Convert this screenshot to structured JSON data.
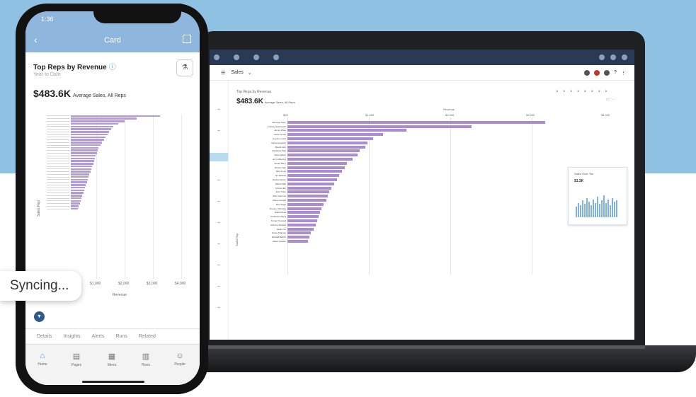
{
  "phone": {
    "status_time": "1:36",
    "nav_title": "Card",
    "card_title": "Top Reps by Revenue",
    "card_subtitle": "Year to Date",
    "big_value": "$483.6K",
    "big_value_label": "Average Sales, All Reps",
    "x_ticks": [
      "$1,000",
      "$2,000",
      "$3,000",
      "$4,000"
    ],
    "x_label": "Revenue",
    "y_label": "Sales Rep",
    "tabs": [
      "Details",
      "Insights",
      "Alerts",
      "Runs",
      "Related"
    ],
    "bottom_nav": [
      {
        "label": "Home",
        "icon": "home-icon"
      },
      {
        "label": "Pages",
        "icon": "pages-icon"
      },
      {
        "label": "Menu",
        "icon": "grid-icon"
      },
      {
        "label": "Runs",
        "icon": "runs-icon"
      },
      {
        "label": "People",
        "icon": "people-icon"
      }
    ],
    "bars": [
      1.0,
      0.74,
      0.6,
      0.53,
      0.48,
      0.45,
      0.43,
      0.41,
      0.39,
      0.37,
      0.35,
      0.33,
      0.31,
      0.3,
      0.29,
      0.28,
      0.27,
      0.26,
      0.25,
      0.24,
      0.23,
      0.22,
      0.21,
      0.2,
      0.19,
      0.18,
      0.17,
      0.16,
      0.15,
      0.14,
      0.13,
      0.12,
      0.11,
      0.1,
      0.09,
      0.08
    ]
  },
  "toast": {
    "text": "Syncing..."
  },
  "laptop": {
    "page_title": "Sales",
    "card_title": "Top Reps by Revenue",
    "big_value": "$483.6K",
    "big_value_label": "Average Sales, All Reps",
    "x_label": "Revenue",
    "x_ticks": [
      "$0K",
      "$1,000",
      "$2,000",
      "$3,000",
      "$4,000"
    ],
    "y_label": "Sales Rep",
    "mini_card_title": "Sales Over Tim",
    "mini_card_value": "$1.2K",
    "reps": [
      {
        "name": "Vanessa Tracs",
        "v": 1.0
      },
      {
        "name": "Lindsay Gainsworth",
        "v": 0.71
      },
      {
        "name": "James Rhee",
        "v": 0.46
      },
      {
        "name": "Hazel Conde",
        "v": 0.37
      },
      {
        "name": "Hayden Lewis",
        "v": 0.33
      },
      {
        "name": "Neha Gonzalez",
        "v": 0.31
      },
      {
        "name": "Brandi Ajiro",
        "v": 0.3
      },
      {
        "name": "Candance Bari",
        "v": 0.28
      },
      {
        "name": "Dave Gilbert",
        "v": 0.27
      },
      {
        "name": "Jerry Manning",
        "v": 0.25
      },
      {
        "name": "Chase Berry",
        "v": 0.23
      },
      {
        "name": "Bracko Tam",
        "v": 0.22
      },
      {
        "name": "Ellie Ames",
        "v": 0.21
      },
      {
        "name": "Ian Mitchell",
        "v": 0.2
      },
      {
        "name": "Daniel Carson",
        "v": 0.19
      },
      {
        "name": "Robert Rife",
        "v": 0.18
      },
      {
        "name": "Chiwen Bin",
        "v": 0.17
      },
      {
        "name": "Eliot Trube",
        "v": 0.16
      },
      {
        "name": "Bob Crammel",
        "v": 0.155
      },
      {
        "name": "Chloe Overlad",
        "v": 0.15
      },
      {
        "name": "Bret Singh",
        "v": 0.14
      },
      {
        "name": "Roxann Shinosky",
        "v": 0.13
      },
      {
        "name": "Nakia Ribes",
        "v": 0.125
      },
      {
        "name": "Perkinson Mena",
        "v": 0.12
      },
      {
        "name": "Tomas Trowand",
        "v": 0.115
      },
      {
        "name": "Anthony Marwell",
        "v": 0.11
      },
      {
        "name": "Justin Yeo",
        "v": 0.1
      },
      {
        "name": "Grace Shaman",
        "v": 0.09
      },
      {
        "name": "Randall Bellvin",
        "v": 0.085
      },
      {
        "name": "Dawn Kessler",
        "v": 0.08
      }
    ],
    "mini_bars": [
      0.45,
      0.6,
      0.5,
      0.7,
      0.55,
      0.8,
      0.65,
      0.5,
      0.75,
      0.6,
      0.85,
      0.55,
      0.7,
      0.9,
      0.6,
      0.75,
      0.5,
      0.8,
      0.65,
      0.7
    ]
  }
}
